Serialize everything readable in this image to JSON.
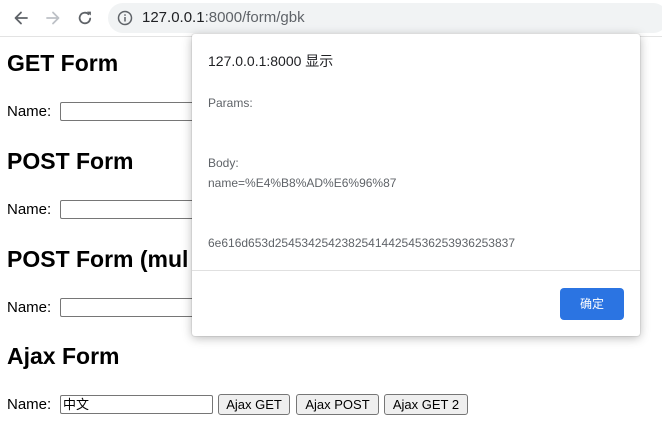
{
  "browser": {
    "url_host": "127.0.0.1",
    "url_rest": ":8000/form/gbk"
  },
  "page": {
    "get_form": {
      "heading": "GET Form",
      "label": "Name:",
      "value": ""
    },
    "post_form": {
      "heading": "POST Form",
      "label": "Name:",
      "value": ""
    },
    "post_form_multipart": {
      "heading": "POST Form (mul",
      "label": "Name:",
      "value": ""
    },
    "ajax_form": {
      "heading": "Ajax Form",
      "label": "Name:",
      "value": "中文",
      "buttons": [
        "Ajax GET",
        "Ajax POST",
        "Ajax GET 2"
      ]
    }
  },
  "dialog": {
    "title": "127.0.0.1:8000 显示",
    "lines": [
      "Params:",
      "Body:",
      "name=%E4%B8%AD%E6%96%87",
      "6e616d653d254534254238254144254536253936253837"
    ],
    "ok_label": "确定"
  },
  "colors": {
    "accent": "#2b74e2",
    "omnibox_bg": "#f1f3f4"
  }
}
